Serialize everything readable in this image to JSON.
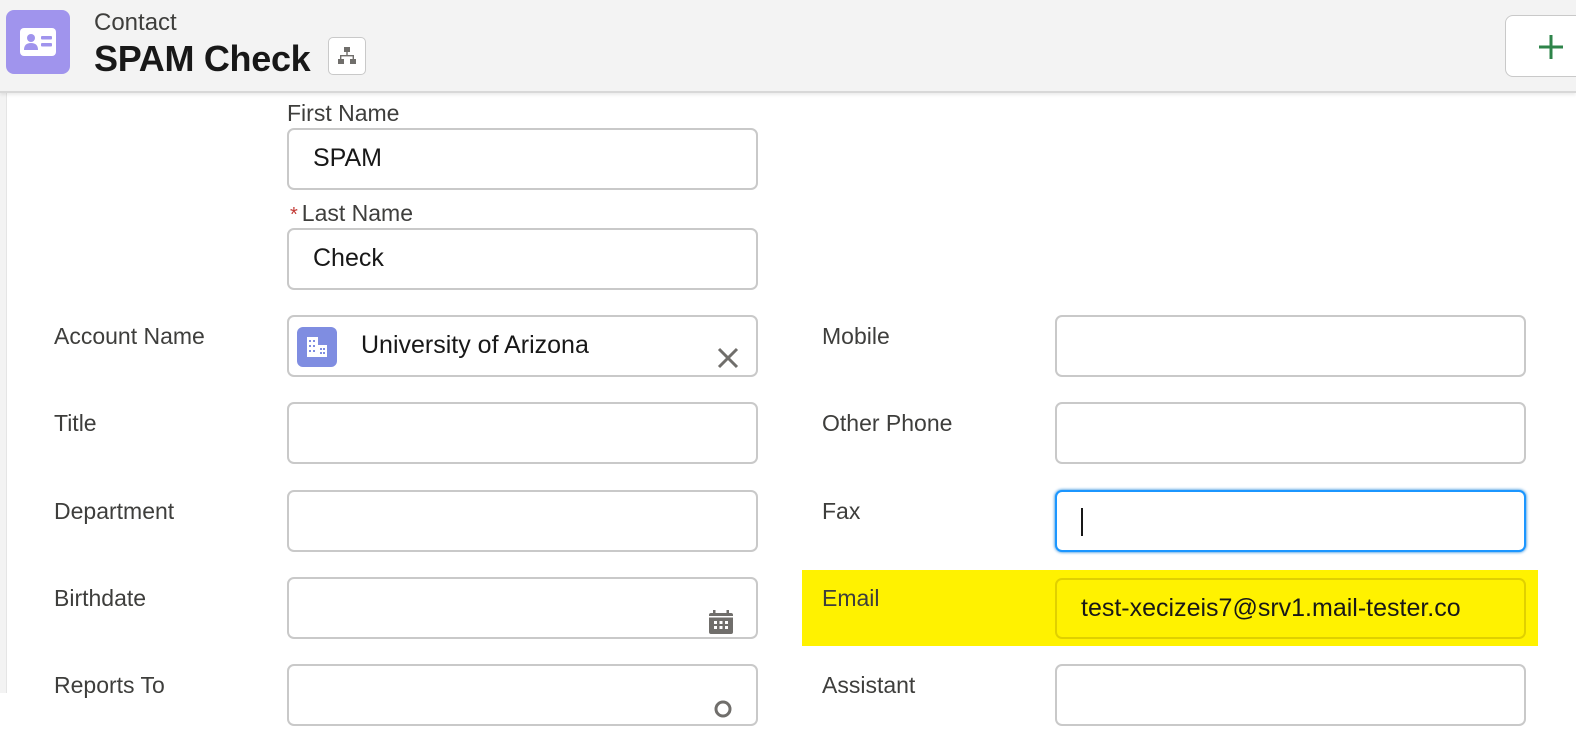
{
  "header": {
    "object_type": "Contact",
    "record_name": "SPAM Check",
    "icon": "contact-card-icon",
    "hierarchy_icon": "hierarchy-icon",
    "add_icon": "plus-icon"
  },
  "form": {
    "first_name": {
      "label": "First Name",
      "value": "SPAM"
    },
    "last_name": {
      "label": "Last Name",
      "value": "Check",
      "required_marker": "*"
    },
    "account_name": {
      "label": "Account Name",
      "value": "University of Arizona",
      "icon": "account-building-icon",
      "clear_icon": "close-icon"
    },
    "title": {
      "label": "Title",
      "value": ""
    },
    "department": {
      "label": "Department",
      "value": ""
    },
    "birthdate": {
      "label": "Birthdate",
      "value": "",
      "icon": "calendar-icon"
    },
    "reports_to": {
      "label": "Reports To",
      "value": ""
    },
    "mobile": {
      "label": "Mobile",
      "value": ""
    },
    "other_phone": {
      "label": "Other Phone",
      "value": ""
    },
    "fax": {
      "label": "Fax",
      "value": "",
      "focused": true
    },
    "email": {
      "label": "Email",
      "value": "test-xecizeis7@srv1.mail-tester.co",
      "highlight_color": "#fff200"
    },
    "assistant": {
      "label": "Assistant",
      "value": ""
    }
  },
  "colors": {
    "contact_icon_bg": "#a094ed",
    "account_icon_bg": "#7f8de1",
    "focus_border": "#1b96ff",
    "required": "#c23934",
    "add_icon": "#2e844a"
  }
}
